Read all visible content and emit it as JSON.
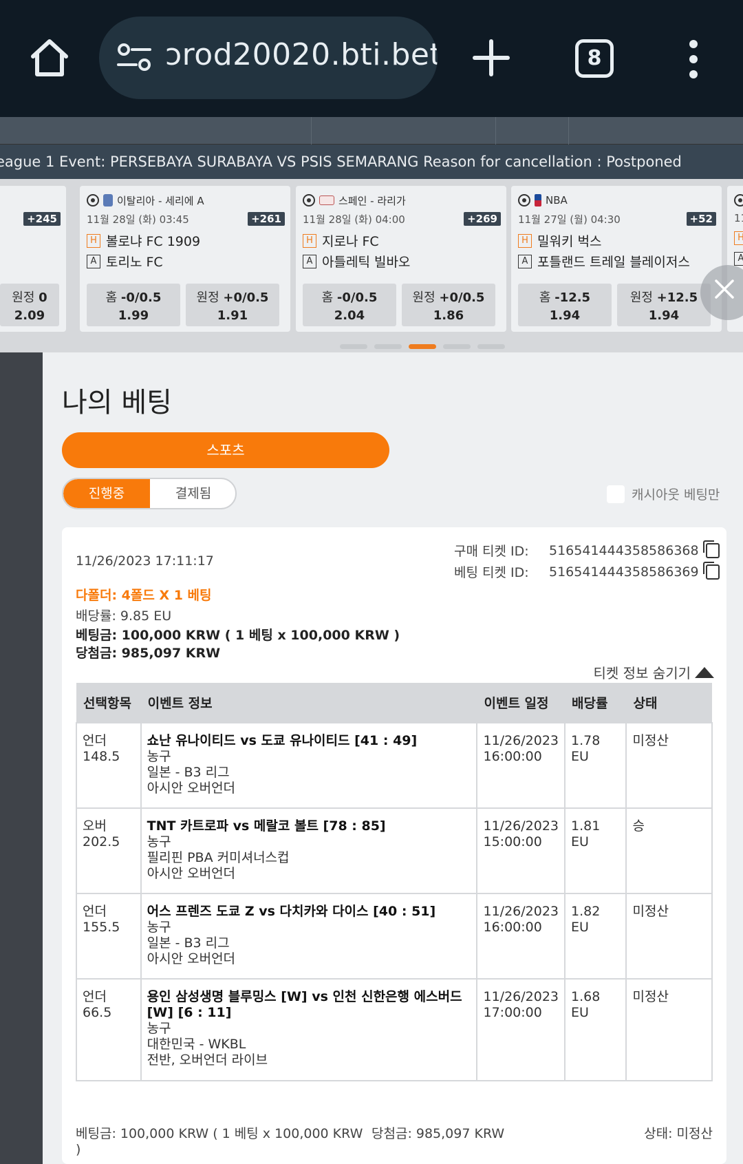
{
  "browser": {
    "url": "prod20020.bti.bet",
    "url_visible": "ɔrod20020.bti.bet",
    "tab_count": "8"
  },
  "ticker": {
    "text": "eague 1 Event: PERSEBAYA SURABAYA VS PSIS SEMARANG Reason for cancellation : Postponed"
  },
  "cards": [
    {
      "league": "",
      "date": "",
      "count": "+245",
      "home": "",
      "away": "",
      "odds": [
        {
          "label": "원정",
          "line": "0",
          "value": "2.09"
        }
      ]
    },
    {
      "league": "이탈리아 - 세리에 A",
      "date": "11월 28일 (화) 03:45",
      "count": "+261",
      "home": "볼로냐 FC 1909",
      "away": "토리노 FC",
      "odds": [
        {
          "label": "홈",
          "line": "-0/0.5",
          "value": "1.99"
        },
        {
          "label": "원정",
          "line": "+0/0.5",
          "value": "1.91"
        }
      ]
    },
    {
      "league": "스페인 - 라리가",
      "date": "11월 28일 (화) 04:00",
      "count": "+269",
      "home": "지로나 FC",
      "away": "아틀레틱 빌바오",
      "odds": [
        {
          "label": "홈",
          "line": "-0/0.5",
          "value": "2.04"
        },
        {
          "label": "원정",
          "line": "+0/0.5",
          "value": "1.86"
        }
      ]
    },
    {
      "league": "NBA",
      "date": "11월 27일 (월) 04:30",
      "count": "+52",
      "home": "밀워키 벅스",
      "away": "포틀랜드 트레일 블레이저스",
      "odds": [
        {
          "label": "홈",
          "line": "-12.5",
          "value": "1.94"
        },
        {
          "label": "원정",
          "line": "+12.5",
          "value": "1.94"
        }
      ]
    }
  ],
  "card_partial_right": {
    "date": "11",
    "ha": "H",
    "ha2": "A"
  },
  "badges": {
    "home": "H",
    "away": "A"
  },
  "pager": {
    "total": 5,
    "active": 2
  },
  "modal": {
    "title": "나의 베팅",
    "sports_tab": "스포츠",
    "seg_active": "진행중",
    "seg_inactive": "결제됨",
    "cashout_only": "캐시아웃 베팅만"
  },
  "ticket": {
    "timestamp": "11/26/2023 17:11:17",
    "purchase_id_label": "구매 티켓 ID:",
    "purchase_id": "516541444358586368",
    "bet_id_label": "베팅 티켓 ID:",
    "bet_id": "516541444358586369",
    "type": "다폴더: 4폴드 X 1 베팅",
    "odds_line": "배당률: 9.85 EU",
    "stake_line": "베팅금: 100,000 KRW ( 1 베팅 x 100,000 KRW )",
    "win_line": "당첨금: 985,097 KRW",
    "hide_info": "티켓 정보 숨기기",
    "headers": {
      "sel": "선택항목",
      "event": "이벤트 정보",
      "date": "이벤트 일정",
      "odds": "배당률",
      "status": "상태"
    },
    "legs": [
      {
        "sel": "언더 148.5",
        "title": "쇼난 유나이티드 vs 도쿄 유나이티드 [41 : 49]",
        "sport": "농구",
        "league": "일본 - B3 리그",
        "market": "아시안 오버언더",
        "date": "11/26/2023 16:00:00",
        "odds": "1.78 EU",
        "status": "미정산"
      },
      {
        "sel": "오버 202.5",
        "title": "TNT 카트로파 vs 메랄코 볼트 [78 : 85]",
        "sport": "농구",
        "league": "필리핀 PBA 커미셔너스컵",
        "market": "아시안 오버언더",
        "date": "11/26/2023 15:00:00",
        "odds": "1.81 EU",
        "status": "승"
      },
      {
        "sel": "언더 155.5",
        "title": "어스 프렌즈 도쿄 Z vs 다치카와 다이스 [40 : 51]",
        "sport": "농구",
        "league": "일본 - B3 리그",
        "market": "아시안 오버언더",
        "date": "11/26/2023 16:00:00",
        "odds": "1.82 EU",
        "status": "미정산"
      },
      {
        "sel": "언더 66.5",
        "title": "용인 삼성생명 블루밍스 [W] vs 인천 신한은행 에스버드 [W] [6 : 11]",
        "sport": "농구",
        "league": "대한민국 - WKBL",
        "market": "전반, 오버언더 라이브",
        "date": "11/26/2023 17:00:00",
        "odds": "1.68 EU",
        "status": "미정산"
      }
    ],
    "footer_stake": "베팅금: 100,000 KRW ( 1 베팅 x 100,000 KRW )",
    "footer_win": "당첨금: 985,097 KRW",
    "footer_status": "상태: 미정산"
  },
  "colors": {
    "accent": "#f87a0b",
    "chrome": "#0f1a24",
    "ticker": "#384653"
  }
}
